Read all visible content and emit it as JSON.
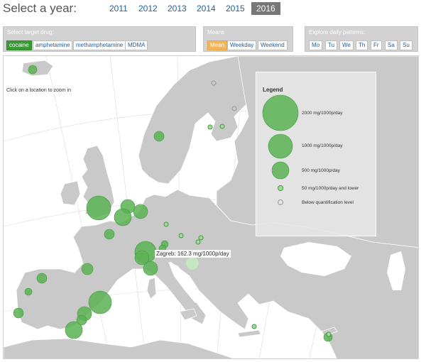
{
  "header": {
    "title": "Select a year:",
    "years": [
      "2011",
      "2012",
      "2013",
      "2014",
      "2015",
      "2016"
    ],
    "active_year": "2016"
  },
  "drug_panel": {
    "title": "Select target drug:",
    "options": [
      "cocaine",
      "amphetamine",
      "methamphetamine",
      "MDMA"
    ],
    "active": "cocaine"
  },
  "means_panel": {
    "title": "Means",
    "options": [
      "Mean",
      "Weekday",
      "Weekend"
    ],
    "active": "Mean"
  },
  "daily_panel": {
    "title": "Explore daily patterns:",
    "options": [
      "Mo",
      "Tu",
      "We",
      "Th",
      "Fr",
      "Sa",
      "Su"
    ]
  },
  "map": {
    "hint": "Click on a location to zoom in",
    "tooltip": "Zagreb: 162.3 mg/1000p/day",
    "colors": {
      "bubble_fill": "#5bb353",
      "bubble_stroke": "#3f9a3a",
      "highlight_fill": "#c7e7c2",
      "land": "#c9c9c9",
      "border": "#ffffff"
    }
  },
  "legend": {
    "title": "Legend",
    "items": [
      "2000 mg/1000p/day",
      "1000 mg/1000p/day",
      "500 mg/1000p/day",
      "50 mg/1000p/day and lower",
      "Below quantification level"
    ]
  }
}
